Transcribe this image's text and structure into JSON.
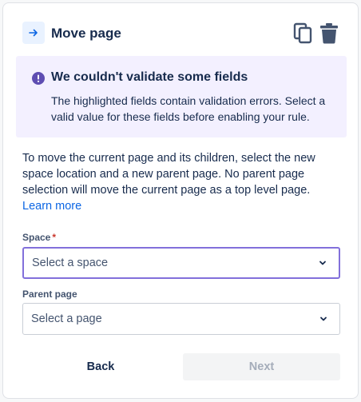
{
  "header": {
    "title": "Move page",
    "move_icon": "arrow-right-icon",
    "copy_icon": "copy-icon",
    "delete_icon": "trash-icon"
  },
  "alert": {
    "icon": "exclamation-icon",
    "title": "We couldn't validate some fields",
    "body": "The highlighted fields contain validation errors. Select a valid value for these fields before enabling your rule."
  },
  "description": {
    "text": "To move the current page and its children, select the new space location and a new parent page. No parent page selection will move the current page as a top level page.",
    "link": "Learn more"
  },
  "fields": {
    "space": {
      "label": "Space",
      "required_marker": "*",
      "placeholder": "Select a space"
    },
    "parent": {
      "label": "Parent page",
      "placeholder": "Select a page"
    }
  },
  "footer": {
    "back_label": "Back",
    "next_label": "Next"
  },
  "colors": {
    "accent_purple": "#8270db",
    "alert_bg": "#f3f0ff",
    "link": "#0c66e4"
  }
}
